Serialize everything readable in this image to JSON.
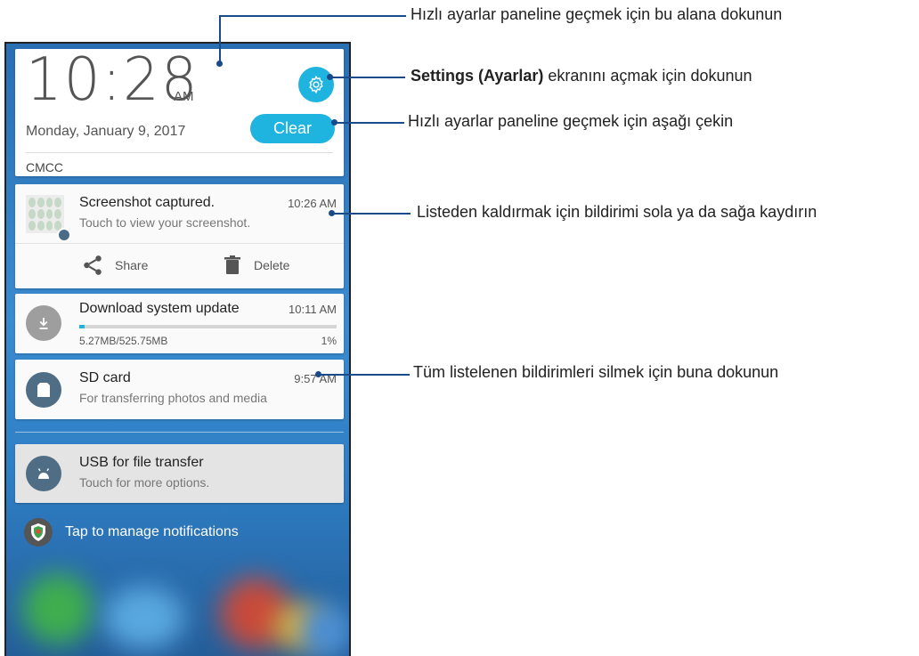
{
  "header": {
    "time": "10:28",
    "ampm": "AM",
    "date": "Monday, January 9, 2017",
    "carrier": "CMCC",
    "settings_icon": "gear-icon",
    "clear_label": "Clear"
  },
  "notifications": {
    "screenshot": {
      "title": "Screenshot captured.",
      "subtitle": "Touch to view your screenshot.",
      "time": "10:26 AM",
      "share_label": "Share",
      "delete_label": "Delete"
    },
    "download": {
      "title": "Download system update",
      "time": "10:11 AM",
      "size": "5.27MB/525.75MB",
      "percent_label": "1%",
      "progress": 0.01
    },
    "sdcard": {
      "title": "SD card",
      "subtitle": "For transferring photos and media",
      "time": "9:57 AM"
    },
    "usb": {
      "title": "USB for file transfer",
      "subtitle": "Touch for more options."
    }
  },
  "manage": {
    "label": "Tap to manage notifications"
  },
  "callouts": {
    "quick_settings_tap": "Hızlı ayarlar paneline geçmek için bu alana dokunun",
    "settings_bold": "Settings (Ayarlar)",
    "settings_rest": " ekranını açmak için dokunun",
    "quick_settings_pull": "Hızlı ayarlar paneline geçmek için aşağı çekin",
    "swipe_remove": "Listeden kaldırmak için bildirimi sola ya da sağa kaydırın",
    "clear_all": "Tüm listelenen bildirimleri silmek için buna dokunun"
  },
  "colors": {
    "accent": "#1fb4e0",
    "callout_line": "#1a4a8a"
  }
}
